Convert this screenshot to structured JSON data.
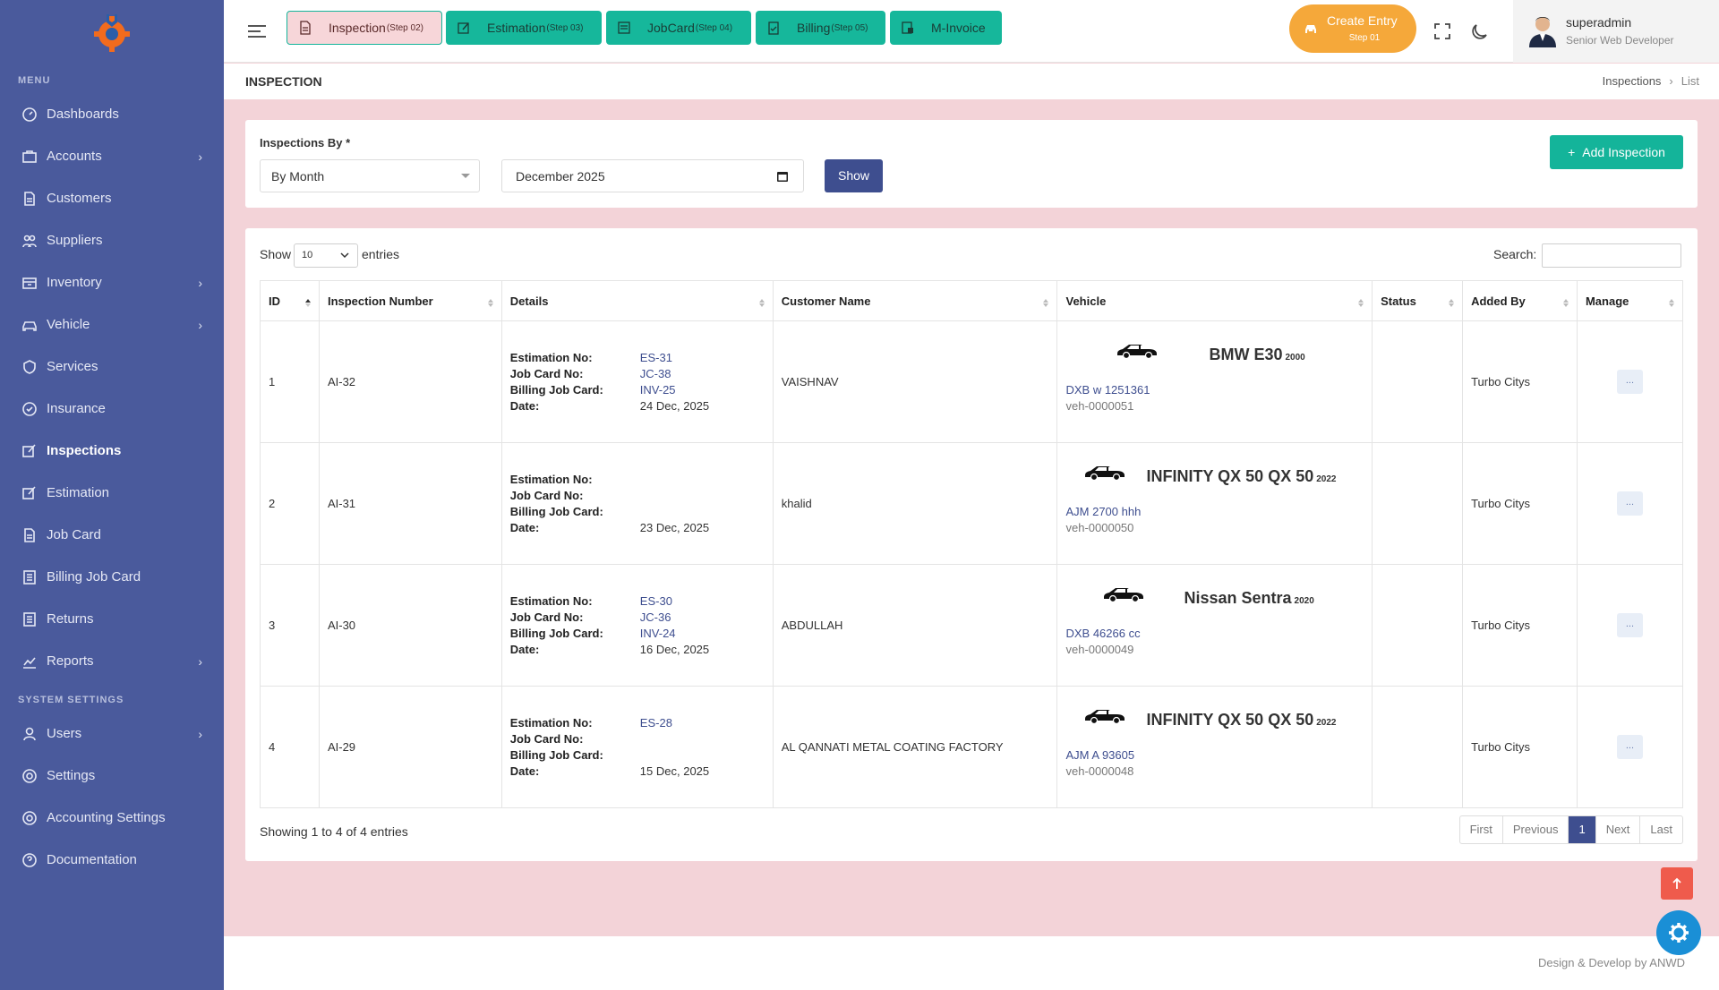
{
  "sidebar": {
    "menu_title": "MENU",
    "system_title": "SYSTEM SETTINGS",
    "items": [
      {
        "label": "Dashboards",
        "icon": "dashboard-icon"
      },
      {
        "label": "Accounts",
        "icon": "briefcase-icon",
        "has_sub": true
      },
      {
        "label": "Customers",
        "icon": "document-icon"
      },
      {
        "label": "Suppliers",
        "icon": "people-icon"
      },
      {
        "label": "Inventory",
        "icon": "box-icon",
        "has_sub": true
      },
      {
        "label": "Vehicle",
        "icon": "car-icon",
        "has_sub": true
      },
      {
        "label": "Services",
        "icon": "shield-icon"
      },
      {
        "label": "Insurance",
        "icon": "insurance-icon"
      },
      {
        "label": "Inspections",
        "icon": "edit-icon",
        "active": true
      },
      {
        "label": "Estimation",
        "icon": "edit-icon"
      },
      {
        "label": "Job Card",
        "icon": "document-icon"
      },
      {
        "label": "Billing Job Card",
        "icon": "list-icon"
      },
      {
        "label": "Returns",
        "icon": "list-icon"
      },
      {
        "label": "Reports",
        "icon": "chart-icon",
        "has_sub": true
      }
    ],
    "system_items": [
      {
        "label": "Users",
        "icon": "user-icon",
        "has_sub": true
      },
      {
        "label": "Settings",
        "icon": "gear-icon"
      },
      {
        "label": "Accounting Settings",
        "icon": "gear-icon"
      },
      {
        "label": "Documentation",
        "icon": "help-icon"
      }
    ]
  },
  "topbar": {
    "steps": [
      {
        "label": "Inspection",
        "sub": "(Step 02)"
      },
      {
        "label": "Estimation",
        "sub": "(Step 03)"
      },
      {
        "label": "JobCard",
        "sub": "(Step 04)"
      },
      {
        "label": "Billing",
        "sub": "(Step 05)"
      },
      {
        "label": "M-Invoice",
        "sub": ""
      }
    ],
    "create_entry": "Create Entry",
    "create_step": "Step 01",
    "user_name": "superadmin",
    "user_role": "Senior Web Developer"
  },
  "page": {
    "title": "INSPECTION",
    "breadcrumb": [
      "Inspections",
      "List"
    ]
  },
  "filter": {
    "label": "Inspections By *",
    "by_value": "By Month",
    "month_value": "December 2025",
    "show_label": "Show",
    "add_label": "Add Inspection"
  },
  "table_controls": {
    "show": "Show",
    "entries_value": "10",
    "entries": "entries",
    "search": "Search:"
  },
  "table": {
    "headers": [
      "ID",
      "Inspection Number",
      "Details",
      "Customer Name",
      "Vehicle",
      "Status",
      "Added By",
      "Manage"
    ],
    "detail_keys": [
      "Estimation No:",
      "Job Card No:",
      "Billing Job Card:",
      "Date:"
    ],
    "rows": [
      {
        "id": "1",
        "number": "AI-32",
        "est": "ES-31",
        "job": "JC-38",
        "bill": "INV-25",
        "date": "24 Dec, 2025",
        "customer": "VAISHNAV",
        "vehicle": "BMW E30",
        "year": "2000",
        "plate": "DXB w 1251361",
        "veh_id": "veh-0000051",
        "status": "",
        "added_by": "Turbo Citys",
        "manage": "..."
      },
      {
        "id": "2",
        "number": "AI-31",
        "est": "",
        "job": "",
        "bill": "",
        "date": "23 Dec, 2025",
        "customer": "khalid",
        "vehicle": "INFINITY QX 50 QX 50",
        "year": "2022",
        "plate": "AJM 2700 hhh",
        "veh_id": "veh-0000050",
        "status": "",
        "added_by": "Turbo Citys",
        "manage": "..."
      },
      {
        "id": "3",
        "number": "AI-30",
        "est": "ES-30",
        "job": "JC-36",
        "bill": "INV-24",
        "date": "16 Dec, 2025",
        "customer": "ABDULLAH",
        "vehicle": "Nissan Sentra",
        "year": "2020",
        "plate": "DXB 46266 cc",
        "veh_id": "veh-0000049",
        "status": "",
        "added_by": "Turbo Citys",
        "manage": "..."
      },
      {
        "id": "4",
        "number": "AI-29",
        "est": "ES-28",
        "job": "",
        "bill": "",
        "date": "15 Dec, 2025",
        "customer": "AL QANNATI METAL COATING FACTORY",
        "vehicle": "INFINITY QX 50 QX 50",
        "year": "2022",
        "plate": "AJM A 93605",
        "veh_id": "veh-0000048",
        "status": "",
        "added_by": "Turbo Citys",
        "manage": "..."
      }
    ]
  },
  "footer_info": "Showing 1 to 4 of 4 entries",
  "pager": [
    "First",
    "Previous",
    "1",
    "Next",
    "Last"
  ],
  "footer": "Design & Develop by ANWD",
  "colors": {
    "sidebar": "#4a5a9c",
    "primary": "#3e4e8f",
    "teal": "#14b49a",
    "orange": "#f5a83a",
    "page_bg": "#f3d3d8"
  }
}
